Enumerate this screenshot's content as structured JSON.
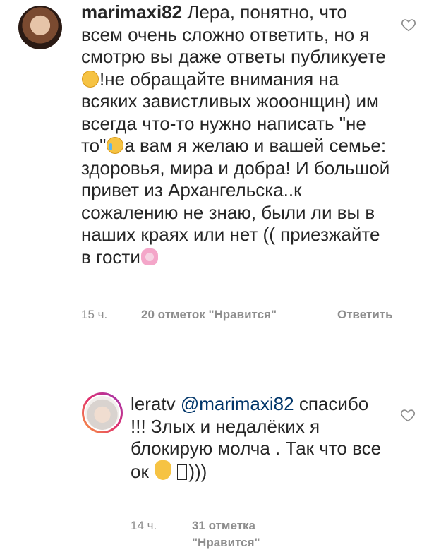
{
  "comments": [
    {
      "username": "marimaxi82",
      "text_a": "Лера, понятно, что всем очень сложно ответить, но я смотрю вы даже ответы публикуете",
      "emoji_a": "kissing-face-emoji",
      "text_b": "!не обращайте внимания на всяких завистливых жооонщин) им всегда что-то нужно написать \"не то\"",
      "emoji_b": "crying-laughing-emoji",
      "text_c": "а вам я желаю и вашей семье: здоровья, мира и добра! И большой привет из Архангельска..к сожалению не знаю, были ли вы в наших краях или нет (( приезжайте в гости",
      "emoji_c": "cherry-blossom-emoji",
      "time": "15 ч.",
      "likes": "20 отметок \"Нравится\"",
      "reply_label": "Ответить"
    },
    {
      "username": "leratv",
      "mention": "@marimaxi82",
      "text_a": "спасибо !!! Злых и недалёких я блокирую молча . Так что все ок",
      "emoji_a": "ok-hand-emoji",
      "text_b": ")))",
      "time": "14 ч.",
      "likes": "31 отметка \"Нравится\""
    }
  ],
  "icons": {
    "like": "heart-outline-icon"
  }
}
